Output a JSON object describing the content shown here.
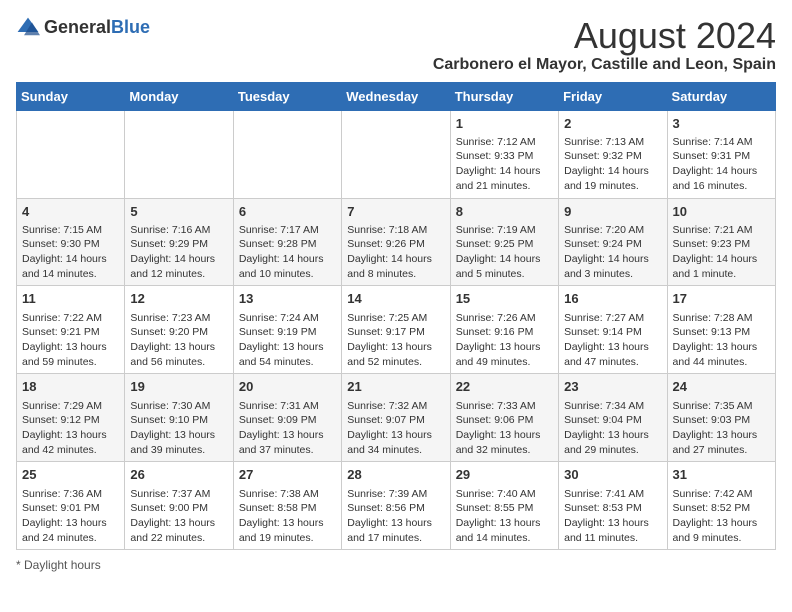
{
  "logo": {
    "general": "General",
    "blue": "Blue"
  },
  "title": "August 2024",
  "location": "Carbonero el Mayor, Castille and Leon, Spain",
  "days_of_week": [
    "Sunday",
    "Monday",
    "Tuesday",
    "Wednesday",
    "Thursday",
    "Friday",
    "Saturday"
  ],
  "footer": "Daylight hours",
  "weeks": [
    [
      {
        "day": "",
        "info": ""
      },
      {
        "day": "",
        "info": ""
      },
      {
        "day": "",
        "info": ""
      },
      {
        "day": "",
        "info": ""
      },
      {
        "day": "1",
        "info": "Sunrise: 7:12 AM\nSunset: 9:33 PM\nDaylight: 14 hours and 21 minutes."
      },
      {
        "day": "2",
        "info": "Sunrise: 7:13 AM\nSunset: 9:32 PM\nDaylight: 14 hours and 19 minutes."
      },
      {
        "day": "3",
        "info": "Sunrise: 7:14 AM\nSunset: 9:31 PM\nDaylight: 14 hours and 16 minutes."
      }
    ],
    [
      {
        "day": "4",
        "info": "Sunrise: 7:15 AM\nSunset: 9:30 PM\nDaylight: 14 hours and 14 minutes."
      },
      {
        "day": "5",
        "info": "Sunrise: 7:16 AM\nSunset: 9:29 PM\nDaylight: 14 hours and 12 minutes."
      },
      {
        "day": "6",
        "info": "Sunrise: 7:17 AM\nSunset: 9:28 PM\nDaylight: 14 hours and 10 minutes."
      },
      {
        "day": "7",
        "info": "Sunrise: 7:18 AM\nSunset: 9:26 PM\nDaylight: 14 hours and 8 minutes."
      },
      {
        "day": "8",
        "info": "Sunrise: 7:19 AM\nSunset: 9:25 PM\nDaylight: 14 hours and 5 minutes."
      },
      {
        "day": "9",
        "info": "Sunrise: 7:20 AM\nSunset: 9:24 PM\nDaylight: 14 hours and 3 minutes."
      },
      {
        "day": "10",
        "info": "Sunrise: 7:21 AM\nSunset: 9:23 PM\nDaylight: 14 hours and 1 minute."
      }
    ],
    [
      {
        "day": "11",
        "info": "Sunrise: 7:22 AM\nSunset: 9:21 PM\nDaylight: 13 hours and 59 minutes."
      },
      {
        "day": "12",
        "info": "Sunrise: 7:23 AM\nSunset: 9:20 PM\nDaylight: 13 hours and 56 minutes."
      },
      {
        "day": "13",
        "info": "Sunrise: 7:24 AM\nSunset: 9:19 PM\nDaylight: 13 hours and 54 minutes."
      },
      {
        "day": "14",
        "info": "Sunrise: 7:25 AM\nSunset: 9:17 PM\nDaylight: 13 hours and 52 minutes."
      },
      {
        "day": "15",
        "info": "Sunrise: 7:26 AM\nSunset: 9:16 PM\nDaylight: 13 hours and 49 minutes."
      },
      {
        "day": "16",
        "info": "Sunrise: 7:27 AM\nSunset: 9:14 PM\nDaylight: 13 hours and 47 minutes."
      },
      {
        "day": "17",
        "info": "Sunrise: 7:28 AM\nSunset: 9:13 PM\nDaylight: 13 hours and 44 minutes."
      }
    ],
    [
      {
        "day": "18",
        "info": "Sunrise: 7:29 AM\nSunset: 9:12 PM\nDaylight: 13 hours and 42 minutes."
      },
      {
        "day": "19",
        "info": "Sunrise: 7:30 AM\nSunset: 9:10 PM\nDaylight: 13 hours and 39 minutes."
      },
      {
        "day": "20",
        "info": "Sunrise: 7:31 AM\nSunset: 9:09 PM\nDaylight: 13 hours and 37 minutes."
      },
      {
        "day": "21",
        "info": "Sunrise: 7:32 AM\nSunset: 9:07 PM\nDaylight: 13 hours and 34 minutes."
      },
      {
        "day": "22",
        "info": "Sunrise: 7:33 AM\nSunset: 9:06 PM\nDaylight: 13 hours and 32 minutes."
      },
      {
        "day": "23",
        "info": "Sunrise: 7:34 AM\nSunset: 9:04 PM\nDaylight: 13 hours and 29 minutes."
      },
      {
        "day": "24",
        "info": "Sunrise: 7:35 AM\nSunset: 9:03 PM\nDaylight: 13 hours and 27 minutes."
      }
    ],
    [
      {
        "day": "25",
        "info": "Sunrise: 7:36 AM\nSunset: 9:01 PM\nDaylight: 13 hours and 24 minutes."
      },
      {
        "day": "26",
        "info": "Sunrise: 7:37 AM\nSunset: 9:00 PM\nDaylight: 13 hours and 22 minutes."
      },
      {
        "day": "27",
        "info": "Sunrise: 7:38 AM\nSunset: 8:58 PM\nDaylight: 13 hours and 19 minutes."
      },
      {
        "day": "28",
        "info": "Sunrise: 7:39 AM\nSunset: 8:56 PM\nDaylight: 13 hours and 17 minutes."
      },
      {
        "day": "29",
        "info": "Sunrise: 7:40 AM\nSunset: 8:55 PM\nDaylight: 13 hours and 14 minutes."
      },
      {
        "day": "30",
        "info": "Sunrise: 7:41 AM\nSunset: 8:53 PM\nDaylight: 13 hours and 11 minutes."
      },
      {
        "day": "31",
        "info": "Sunrise: 7:42 AM\nSunset: 8:52 PM\nDaylight: 13 hours and 9 minutes."
      }
    ]
  ]
}
